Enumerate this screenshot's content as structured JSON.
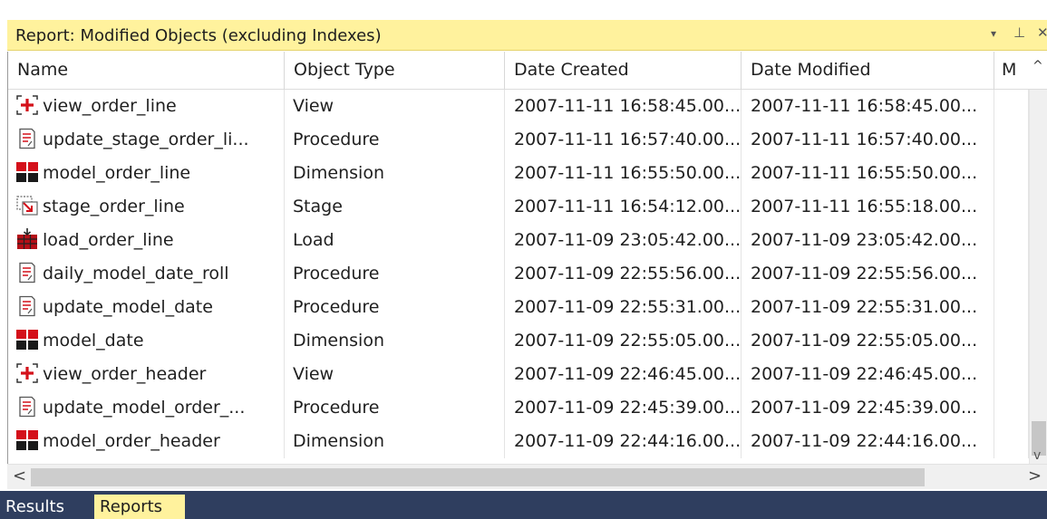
{
  "panel": {
    "title": "Report: Modified Objects (excluding Indexes)",
    "dropdown_glyph": "▾",
    "pin_glyph": "⊥",
    "close_glyph": "✕"
  },
  "columns": [
    "Name",
    "Object Type",
    "Date Created",
    "Date Modified",
    "M"
  ],
  "rows": [
    {
      "icon": "view-icon",
      "name": "view_order_line",
      "type": "View",
      "created": "2007-11-11 16:58:45.00...",
      "modified": "2007-11-11 16:58:45.00..."
    },
    {
      "icon": "procedure-icon",
      "name": "update_stage_order_li...",
      "type": "Procedure",
      "created": "2007-11-11 16:57:40.00...",
      "modified": "2007-11-11 16:57:40.00..."
    },
    {
      "icon": "dimension-icon",
      "name": "model_order_line",
      "type": "Dimension",
      "created": "2007-11-11 16:55:50.00...",
      "modified": "2007-11-11 16:55:50.00..."
    },
    {
      "icon": "stage-icon",
      "name": "stage_order_line",
      "type": "Stage",
      "created": "2007-11-11 16:54:12.00...",
      "modified": "2007-11-11 16:55:18.00..."
    },
    {
      "icon": "load-icon",
      "name": "load_order_line",
      "type": "Load",
      "created": "2007-11-09 23:05:42.00...",
      "modified": "2007-11-09 23:05:42.00..."
    },
    {
      "icon": "procedure-icon",
      "name": "daily_model_date_roll",
      "type": "Procedure",
      "created": "2007-11-09 22:55:56.00...",
      "modified": "2007-11-09 22:55:56.00..."
    },
    {
      "icon": "procedure-icon",
      "name": "update_model_date",
      "type": "Procedure",
      "created": "2007-11-09 22:55:31.00...",
      "modified": "2007-11-09 22:55:31.00..."
    },
    {
      "icon": "dimension-icon",
      "name": "model_date",
      "type": "Dimension",
      "created": "2007-11-09 22:55:05.00...",
      "modified": "2007-11-09 22:55:05.00..."
    },
    {
      "icon": "view-icon",
      "name": "view_order_header",
      "type": "View",
      "created": "2007-11-09 22:46:45.00...",
      "modified": "2007-11-09 22:46:45.00..."
    },
    {
      "icon": "procedure-icon",
      "name": "update_model_order_...",
      "type": "Procedure",
      "created": "2007-11-09 22:45:39.00...",
      "modified": "2007-11-09 22:45:39.00..."
    },
    {
      "icon": "dimension-icon",
      "name": "model_order_header",
      "type": "Dimension",
      "created": "2007-11-09 22:44:16.00...",
      "modified": "2007-11-09 22:44:16.00..."
    }
  ],
  "scrollbars": {
    "up_glyph": "^",
    "down_glyph": "v",
    "left_glyph": "<",
    "right_glyph": ">"
  },
  "tabs": [
    {
      "label": "Results",
      "active": false
    },
    {
      "label": "Reports",
      "active": true
    }
  ],
  "colors": {
    "title_bar": "#fff29d",
    "tab_bar": "#2f3e5f",
    "active_tab": "#fff29d",
    "icon_red": "#d4101a"
  }
}
